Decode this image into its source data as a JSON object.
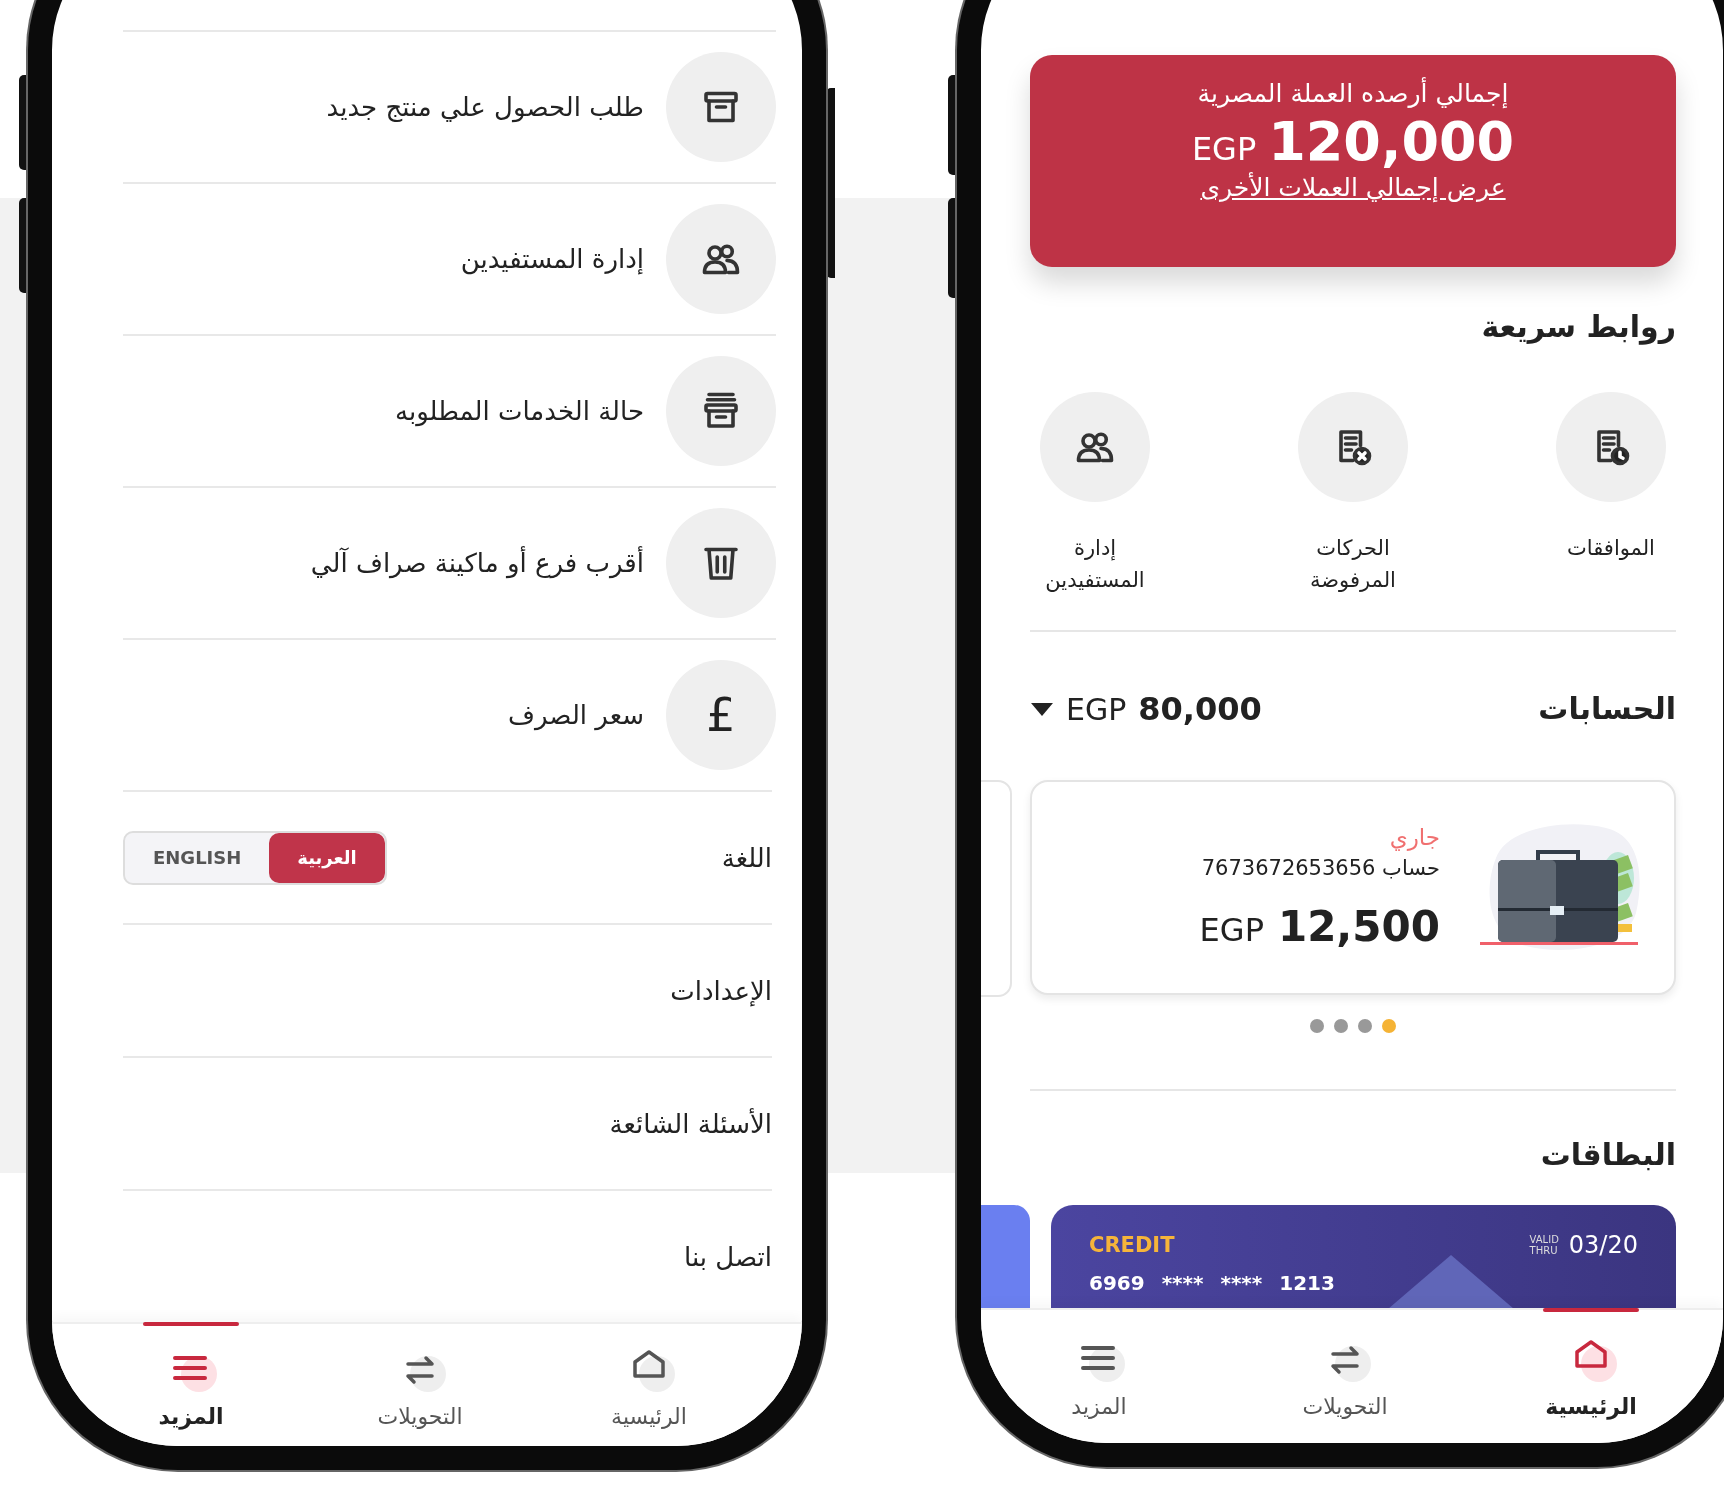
{
  "more_screen": {
    "menu_items": [
      {
        "kind": "icon",
        "label": "طلب الحصول علي منتج جديد"
      },
      {
        "kind": "icon",
        "label": "إدارة المستفيدين"
      },
      {
        "kind": "icon",
        "label": "حالة الخدمات المطلوبه"
      },
      {
        "kind": "icon",
        "label": "أقرب فرع أو ماكينة صراف آلي"
      },
      {
        "kind": "glyph",
        "glyph": "£",
        "label": "سعر الصرف"
      },
      {
        "kind": "language",
        "label": "اللغة",
        "options": [
          {
            "label": "العربية",
            "selected": true
          },
          {
            "label": "ENGLISH",
            "selected": false
          }
        ]
      },
      {
        "kind": "plain",
        "label": "الإعدادات"
      },
      {
        "kind": "plain",
        "label": "الأسئلة الشائعة"
      },
      {
        "kind": "plain",
        "label": "اتصل بنا"
      }
    ],
    "nav": [
      {
        "label": "الرئيسية",
        "selected": false
      },
      {
        "label": "التحويلات",
        "selected": false
      },
      {
        "label": "المزيد",
        "selected": true
      }
    ]
  },
  "home_screen": {
    "balance_card": {
      "title": "إجمالي أرصده العملة المصرية",
      "currency": "EGP",
      "amount": "120,000",
      "link": "عرض إجمالي العملات الأخرى"
    },
    "quick_links": {
      "title": "روابط سريعة",
      "items": [
        {
          "label": "الموافقات"
        },
        {
          "label": "الحركات المرفوضة"
        },
        {
          "label": "إدارة المستفيدين"
        }
      ]
    },
    "accounts": {
      "title": "الحسابات",
      "currency": "EGP",
      "total": "80,000",
      "card": {
        "type": "جاري",
        "account_label": "حساب",
        "account_number": "7673672653656",
        "currency": "EGP",
        "balance": "12,500"
      },
      "pager": [
        {
          "selected": true
        },
        {
          "selected": false
        },
        {
          "selected": false
        },
        {
          "selected": false
        }
      ]
    },
    "cards": {
      "title": "البطاقات",
      "card": {
        "type": "CREDIT",
        "valid_label": [
          "VALID",
          "THRU"
        ],
        "expiry": "03/20",
        "number": "6969 **** **** 1213"
      }
    },
    "nav": [
      {
        "label": "الرئيسية",
        "selected": true
      },
      {
        "label": "التحويلات",
        "selected": false
      },
      {
        "label": "المزيد",
        "selected": false
      }
    ]
  }
}
